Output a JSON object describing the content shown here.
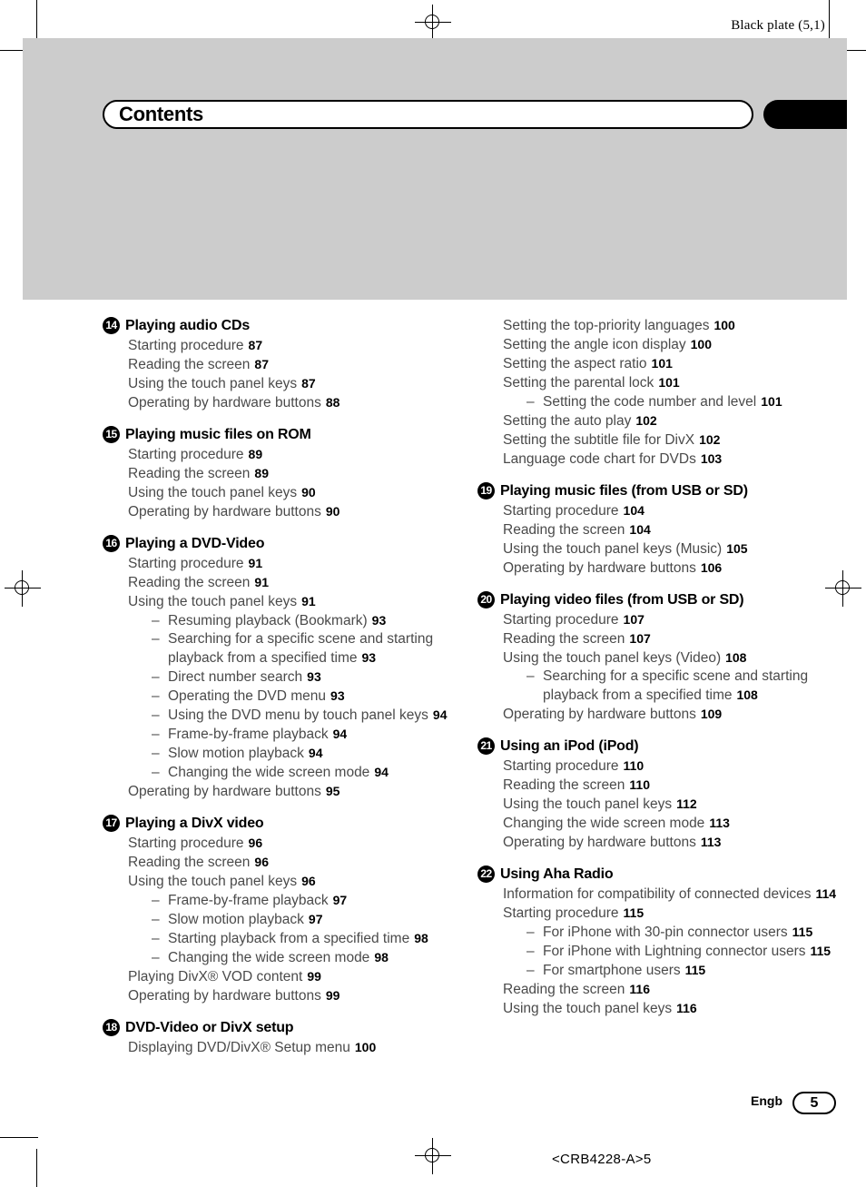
{
  "plate": {
    "label": "Black plate (5,1)"
  },
  "header": {
    "title": "Contents"
  },
  "footer": {
    "language": "Engb",
    "page_number": "5",
    "doc_code": "<CRB4228-A>5"
  },
  "colors": {
    "band": "#cccccc",
    "tab": "#000000",
    "entry_text": "#4a4a4a",
    "page_number": "#000000"
  },
  "columns": [
    {
      "sections": [
        {
          "number": "14",
          "title": "Playing audio CDs",
          "entries": [
            {
              "text": "Starting procedure",
              "page": "87",
              "level": 0
            },
            {
              "text": "Reading the screen",
              "page": "87",
              "level": 0
            },
            {
              "text": "Using the touch panel keys",
              "page": "87",
              "level": 0
            },
            {
              "text": "Operating by hardware buttons",
              "page": "88",
              "level": 0
            }
          ]
        },
        {
          "number": "15",
          "title": "Playing music files on ROM",
          "entries": [
            {
              "text": "Starting procedure",
              "page": "89",
              "level": 0
            },
            {
              "text": "Reading the screen",
              "page": "89",
              "level": 0
            },
            {
              "text": "Using the touch panel keys",
              "page": "90",
              "level": 0
            },
            {
              "text": "Operating by hardware buttons",
              "page": "90",
              "level": 0
            }
          ]
        },
        {
          "number": "16",
          "title": "Playing a DVD-Video",
          "entries": [
            {
              "text": "Starting procedure",
              "page": "91",
              "level": 0
            },
            {
              "text": "Reading the screen",
              "page": "91",
              "level": 0
            },
            {
              "text": "Using the touch panel keys",
              "page": "91",
              "level": 0
            },
            {
              "text": "Resuming playback (Bookmark)",
              "page": "93",
              "level": 1
            },
            {
              "text": "Searching for a specific scene and starting playback from a specified time",
              "page": "93",
              "level": 1
            },
            {
              "text": "Direct number search",
              "page": "93",
              "level": 1
            },
            {
              "text": "Operating the DVD menu",
              "page": "93",
              "level": 1
            },
            {
              "text": "Using the DVD menu by touch panel keys",
              "page": "94",
              "level": 1
            },
            {
              "text": "Frame-by-frame playback",
              "page": "94",
              "level": 1
            },
            {
              "text": "Slow motion playback",
              "page": "94",
              "level": 1
            },
            {
              "text": "Changing the wide screen mode",
              "page": "94",
              "level": 1
            },
            {
              "text": "Operating by hardware buttons",
              "page": "95",
              "level": 0
            }
          ]
        },
        {
          "number": "17",
          "title": "Playing a DivX video",
          "entries": [
            {
              "text": "Starting procedure",
              "page": "96",
              "level": 0
            },
            {
              "text": "Reading the screen",
              "page": "96",
              "level": 0
            },
            {
              "text": "Using the touch panel keys",
              "page": "96",
              "level": 0
            },
            {
              "text": "Frame-by-frame playback",
              "page": "97",
              "level": 1
            },
            {
              "text": "Slow motion playback",
              "page": "97",
              "level": 1
            },
            {
              "text": "Starting playback from a specified time",
              "page": "98",
              "level": 1
            },
            {
              "text": "Changing the wide screen mode",
              "page": "98",
              "level": 1
            },
            {
              "text": "Playing DivX® VOD content",
              "page": "99",
              "level": 0
            },
            {
              "text": "Operating by hardware buttons",
              "page": "99",
              "level": 0
            }
          ]
        },
        {
          "number": "18",
          "title": "DVD-Video or DivX setup",
          "entries": [
            {
              "text": "Displaying DVD/DivX® Setup menu",
              "page": "100",
              "level": 0
            }
          ]
        }
      ]
    },
    {
      "sections": [
        {
          "number": "",
          "title": "",
          "entries": [
            {
              "text": "Setting the top-priority languages",
              "page": "100",
              "level": 0
            },
            {
              "text": "Setting the angle icon display",
              "page": "100",
              "level": 0
            },
            {
              "text": "Setting the aspect ratio",
              "page": "101",
              "level": 0
            },
            {
              "text": "Setting the parental lock",
              "page": "101",
              "level": 0
            },
            {
              "text": "Setting the code number and level",
              "page": "101",
              "level": 1
            },
            {
              "text": "Setting the auto play",
              "page": "102",
              "level": 0
            },
            {
              "text": "Setting the subtitle file for DivX",
              "page": "102",
              "level": 0
            },
            {
              "text": "Language code chart for DVDs",
              "page": "103",
              "level": 0
            }
          ]
        },
        {
          "number": "19",
          "title": "Playing music files (from USB or SD)",
          "entries": [
            {
              "text": "Starting procedure",
              "page": "104",
              "level": 0
            },
            {
              "text": "Reading the screen",
              "page": "104",
              "level": 0
            },
            {
              "text": "Using the touch panel keys (Music)",
              "page": "105",
              "level": 0
            },
            {
              "text": "Operating by hardware buttons",
              "page": "106",
              "level": 0
            }
          ]
        },
        {
          "number": "20",
          "title": "Playing video files (from USB or SD)",
          "entries": [
            {
              "text": "Starting procedure",
              "page": "107",
              "level": 0
            },
            {
              "text": "Reading the screen",
              "page": "107",
              "level": 0
            },
            {
              "text": "Using the touch panel keys (Video)",
              "page": "108",
              "level": 0
            },
            {
              "text": "Searching for a specific scene and starting playback from a specified time",
              "page": "108",
              "level": 1
            },
            {
              "text": "Operating by hardware buttons",
              "page": "109",
              "level": 0
            }
          ]
        },
        {
          "number": "21",
          "title": "Using an iPod (iPod)",
          "entries": [
            {
              "text": "Starting procedure",
              "page": "110",
              "level": 0
            },
            {
              "text": "Reading the screen",
              "page": "110",
              "level": 0
            },
            {
              "text": "Using the touch panel keys",
              "page": "112",
              "level": 0
            },
            {
              "text": "Changing the wide screen mode",
              "page": "113",
              "level": 0
            },
            {
              "text": "Operating by hardware buttons",
              "page": "113",
              "level": 0
            }
          ]
        },
        {
          "number": "22",
          "title": "Using Aha Radio",
          "entries": [
            {
              "text": "Information for compatibility of connected devices",
              "page": "114",
              "level": 0
            },
            {
              "text": "Starting procedure",
              "page": "115",
              "level": 0
            },
            {
              "text": "For iPhone with 30-pin connector users",
              "page": "115",
              "level": 1
            },
            {
              "text": "For iPhone with Lightning connector users",
              "page": "115",
              "level": 1
            },
            {
              "text": "For smartphone users",
              "page": "115",
              "level": 1
            },
            {
              "text": "Reading the screen",
              "page": "116",
              "level": 0
            },
            {
              "text": "Using the touch panel keys",
              "page": "116",
              "level": 0
            }
          ]
        }
      ]
    }
  ]
}
